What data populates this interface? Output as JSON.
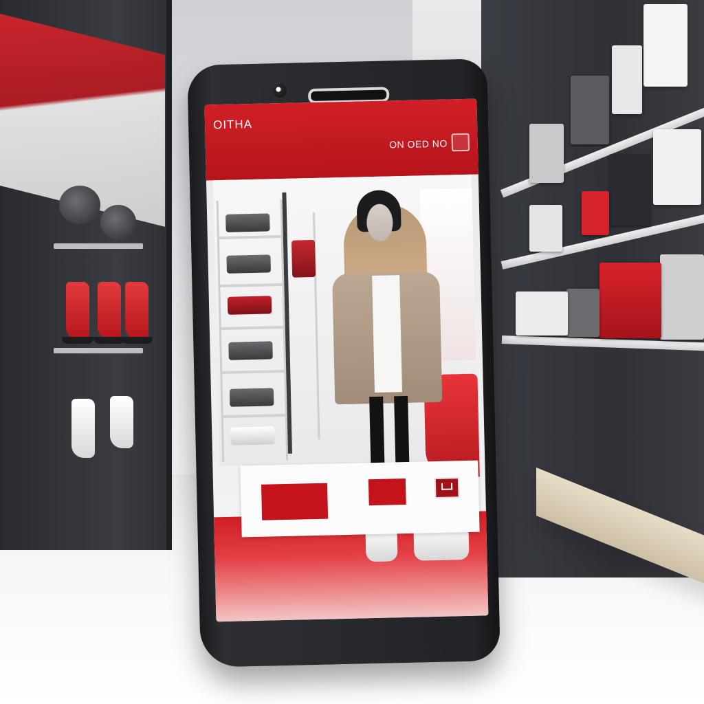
{
  "app": {
    "brand_label": "OITHA",
    "status_label": "ON OED NO"
  },
  "colors": {
    "accent_red": "#c4131b",
    "header_red": "#d11f27",
    "phone_body": "#222327"
  },
  "icons": {
    "header_badge": "tag-icon",
    "cart": "cart-icon",
    "camera": "camera-icon",
    "speaker": "speaker-icon"
  }
}
